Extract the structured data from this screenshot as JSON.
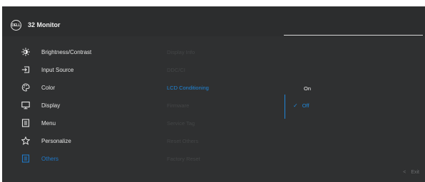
{
  "window": {
    "brand_logo": "DELL",
    "model": "32 Monitor"
  },
  "menu": [
    {
      "icon": "sun-icon",
      "label": "Brightness/Contrast"
    },
    {
      "icon": "input-source-icon",
      "label": "Input Source"
    },
    {
      "icon": "palette-icon",
      "label": "Color"
    },
    {
      "icon": "display-icon",
      "label": "Display"
    },
    {
      "icon": "menu-icon",
      "label": "Menu"
    },
    {
      "icon": "star-icon",
      "label": "Personalize"
    },
    {
      "icon": "others-icon",
      "label": "Others",
      "active": true
    }
  ],
  "submenu": [
    "Display Info",
    "DDC/CI",
    "LCD Conditioning",
    "Firmware",
    "Service Tag",
    "Reset Others",
    "Factory Reset"
  ],
  "submenu_active": "LCD Conditioning",
  "options": {
    "on": "On",
    "off": "Off",
    "selected": "Off"
  },
  "footer": {
    "exit_label": "Exit"
  },
  "colors": {
    "accent": "#1f86d8",
    "background": "#2f3031"
  }
}
